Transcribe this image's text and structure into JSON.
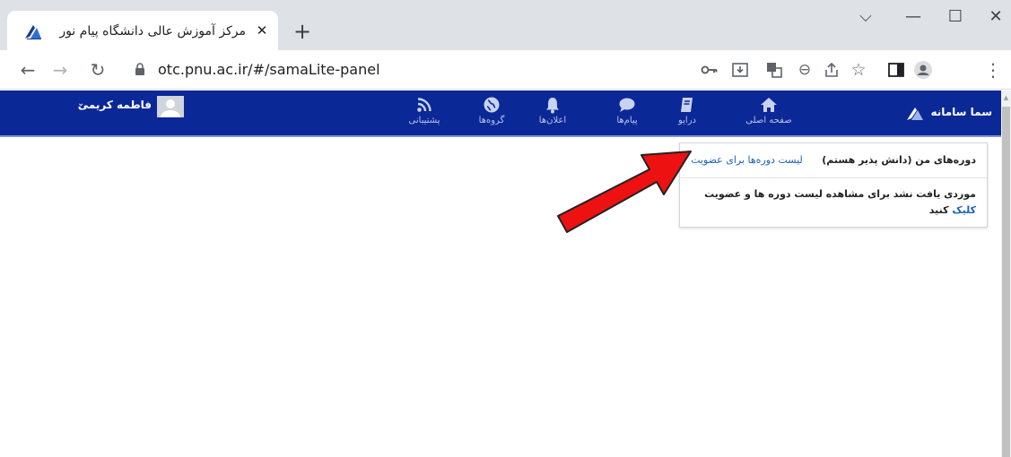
{
  "browser": {
    "tab_title": "مرکز آموزش عالی دانشگاه پیام نور",
    "tab_close": "✕",
    "new_tab": "+",
    "window_controls": {
      "collapse": "⌵",
      "minimize": "—",
      "maximize": "☐",
      "close": "✕"
    },
    "nav": {
      "back": "←",
      "forward": "→",
      "reload": "↻"
    },
    "url": "otc.pnu.ac.ir/#/samaLite-panel",
    "toolbar_icons": [
      "key-icon",
      "install-icon",
      "translate-icon",
      "zoom-icon",
      "share-icon",
      "star-icon",
      "sidepanel-icon",
      "profile-icon",
      "menu-icon"
    ],
    "toolbar_glyphs": {
      "star": "☆",
      "menu": "⋮",
      "zoom": "⊖"
    }
  },
  "app": {
    "brand": "سما سامانه",
    "nav_items": [
      {
        "label": "صفحه اصلی",
        "icon": "home-icon"
      },
      {
        "label": "درایو",
        "icon": "drive-icon"
      },
      {
        "label": "پیام‌ها",
        "icon": "chat-icon"
      },
      {
        "label": "اعلان‌ها",
        "icon": "bell-icon"
      },
      {
        "label": "گروه‌ها",
        "icon": "globe-icon"
      },
      {
        "label": "پشتیبانی",
        "icon": "rss-icon"
      }
    ],
    "user": {
      "name": "فاطمه کریمی",
      "caret": "⌄"
    },
    "accent": "#0b2897",
    "link_color": "#1c62b5"
  },
  "panel": {
    "my_courses": "دوره‌های من (دانش پذیر هستم)",
    "course_list": "لیست دوره‌ها برای عضویت",
    "message_prefix": "موردی یافت نشد برای مشاهده لیست دوره ها و عضویت",
    "message_click": "کلیک",
    "message_suffix": "کنید"
  },
  "annotation": {
    "arrow_color": "#ee1111"
  }
}
